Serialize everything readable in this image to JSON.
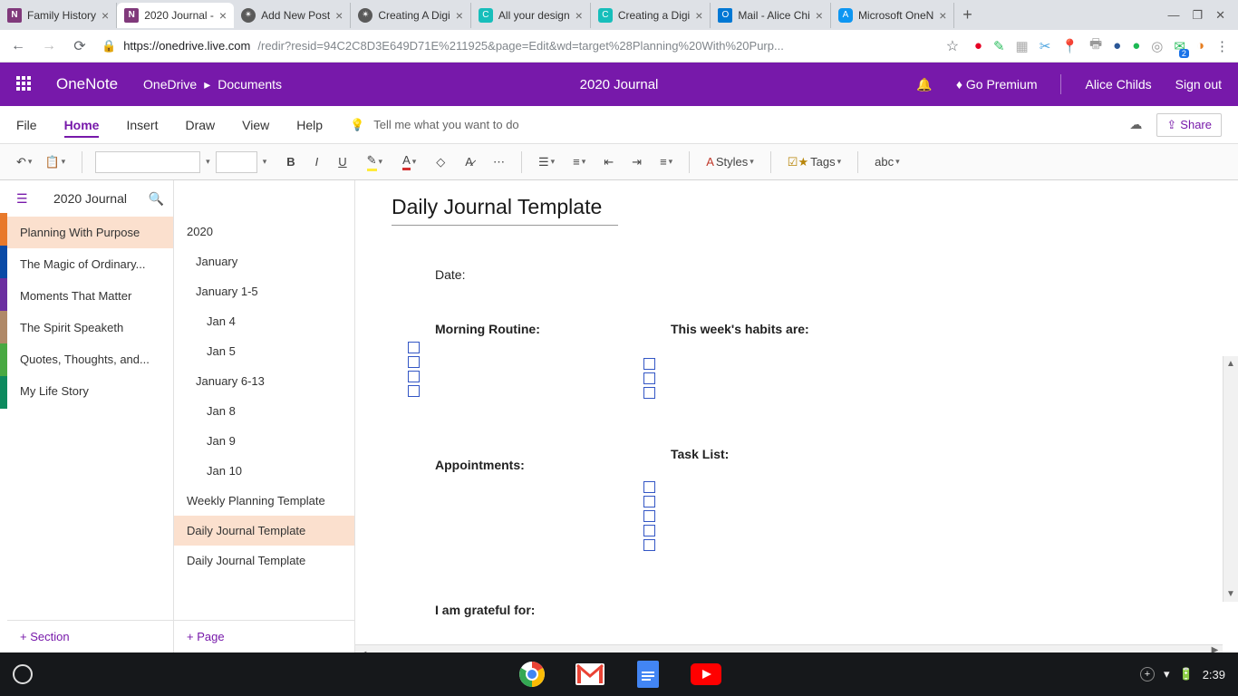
{
  "browser": {
    "tabs": [
      {
        "title": "Family History"
      },
      {
        "title": "2020 Journal -"
      },
      {
        "title": "Add New Post"
      },
      {
        "title": "Creating A Digi"
      },
      {
        "title": "All your design"
      },
      {
        "title": "Creating a Digi"
      },
      {
        "title": "Mail - Alice Chi"
      },
      {
        "title": "Microsoft OneN"
      }
    ],
    "url_host": "https://onedrive.live.com",
    "url_path": "/redir?resid=94C2C8D3E649D71E%211925&page=Edit&wd=target%28Planning%20With%20Purp..."
  },
  "onenote": {
    "app": "OneNote",
    "bc1": "OneDrive",
    "bc2": "Documents",
    "doc_title": "2020 Journal",
    "premium": "Go Premium",
    "user": "Alice Childs",
    "signout": "Sign out"
  },
  "menu": {
    "file": "File",
    "home": "Home",
    "insert": "Insert",
    "draw": "Draw",
    "view": "View",
    "help": "Help",
    "tellme": "Tell me what you want to do",
    "share": "Share"
  },
  "ribbon": {
    "styles": "Styles",
    "tags": "Tags"
  },
  "notebook": {
    "name": "2020 Journal",
    "sections": [
      "Planning With Purpose",
      "The Magic of Ordinary...",
      "Moments That Matter",
      "The Spirit Speaketh",
      "Quotes, Thoughts, and...",
      "My Life Story"
    ],
    "add_section": "+ Section",
    "pages": [
      {
        "t": "2020",
        "i": 0
      },
      {
        "t": "January",
        "i": 1
      },
      {
        "t": "January 1-5",
        "i": 1
      },
      {
        "t": "Jan 4",
        "i": 2
      },
      {
        "t": "Jan 5",
        "i": 2
      },
      {
        "t": "January 6-13",
        "i": 1
      },
      {
        "t": "Jan 8",
        "i": 2
      },
      {
        "t": "Jan 9",
        "i": 2
      },
      {
        "t": "Jan 10",
        "i": 2
      },
      {
        "t": "Weekly Planning Template",
        "i": 0
      },
      {
        "t": "Daily Journal Template",
        "i": 0
      },
      {
        "t": "Daily Journal Template",
        "i": 0
      }
    ],
    "add_page": "+ Page"
  },
  "page": {
    "title": "Daily Journal Template",
    "date_lbl": "Date:",
    "morning": "Morning  Routine:",
    "habits": "This week's habits are:",
    "appts": "Appointments:",
    "tasks": "Task List:",
    "grateful": "I am grateful for:"
  },
  "taskbar": {
    "time": "2:39"
  }
}
